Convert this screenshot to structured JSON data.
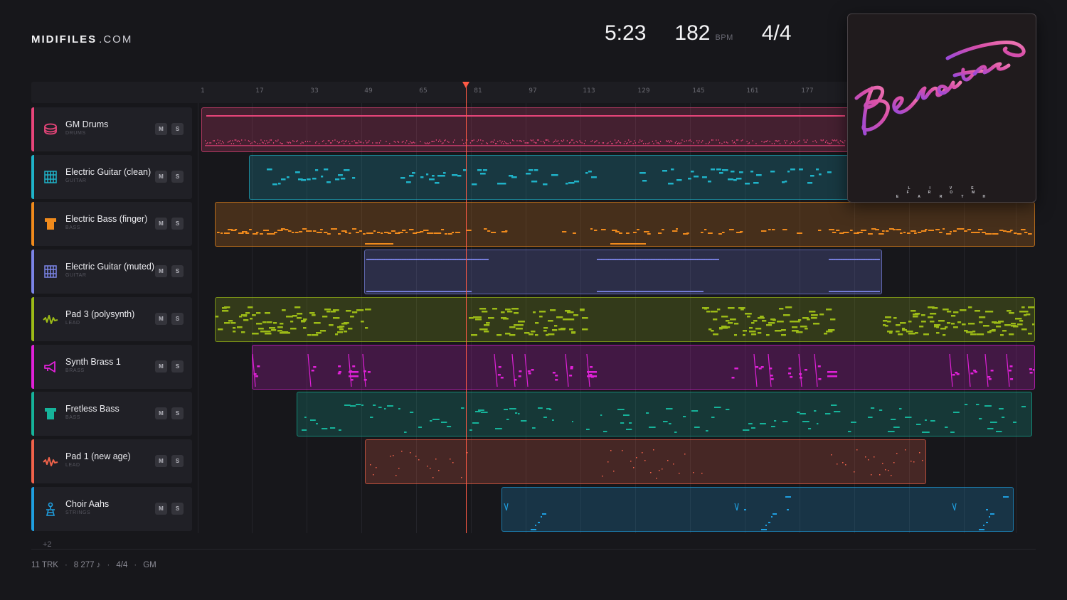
{
  "brand": {
    "name": "MIDIFILES",
    "suffix": ".COM"
  },
  "stats": {
    "time": "5:23",
    "bpm": "182",
    "bpm_label": "BPM",
    "time_signature": "4/4"
  },
  "ruler": {
    "ticks": [
      "1",
      "17",
      "33",
      "49",
      "65",
      "81",
      "97",
      "113",
      "129",
      "145",
      "161",
      "177"
    ]
  },
  "playhead": {
    "bar": 78
  },
  "tracks": [
    {
      "name": "GM Drums",
      "category": "DRUMS",
      "color": "#e8457a",
      "icon": "drum-icon",
      "mute": "M",
      "solo": "S"
    },
    {
      "name": "Electric Guitar (clean)",
      "category": "GUITAR",
      "color": "#1fb3c9",
      "icon": "guitar-icon",
      "mute": "M",
      "solo": "S"
    },
    {
      "name": "Electric Bass (finger)",
      "category": "BASS",
      "color": "#f08a1c",
      "icon": "bass-icon",
      "mute": "M",
      "solo": "S"
    },
    {
      "name": "Electric Guitar (muted)",
      "category": "GUITAR",
      "color": "#7b84e6",
      "icon": "guitar-icon",
      "mute": "M",
      "solo": "S"
    },
    {
      "name": "Pad 3 (polysynth)",
      "category": "LEAD",
      "color": "#9cbb17",
      "icon": "wave-icon",
      "mute": "M",
      "solo": "S"
    },
    {
      "name": "Synth Brass 1",
      "category": "BRASS",
      "color": "#e021d8",
      "icon": "trumpet-icon",
      "mute": "M",
      "solo": "S"
    },
    {
      "name": "Fretless Bass",
      "category": "BASS",
      "color": "#16b39a",
      "icon": "bass-icon",
      "mute": "M",
      "solo": "S"
    },
    {
      "name": "Pad 1 (new age)",
      "category": "LEAD",
      "color": "#f0624a",
      "icon": "wave-icon",
      "mute": "M",
      "solo": "S"
    },
    {
      "name": "Choir Aahs",
      "category": "STRINGS",
      "color": "#1f9fe0",
      "icon": "choir-icon",
      "mute": "M",
      "solo": "S"
    }
  ],
  "more_tracks": "+2",
  "album": {
    "title": "Benatar",
    "tagline": "LIVE FROM EARTH"
  },
  "footer": {
    "tracks": "11 TRK",
    "notes": "8 277 ♪",
    "signature": "4/4",
    "standard": "GM",
    "sep": "·"
  }
}
